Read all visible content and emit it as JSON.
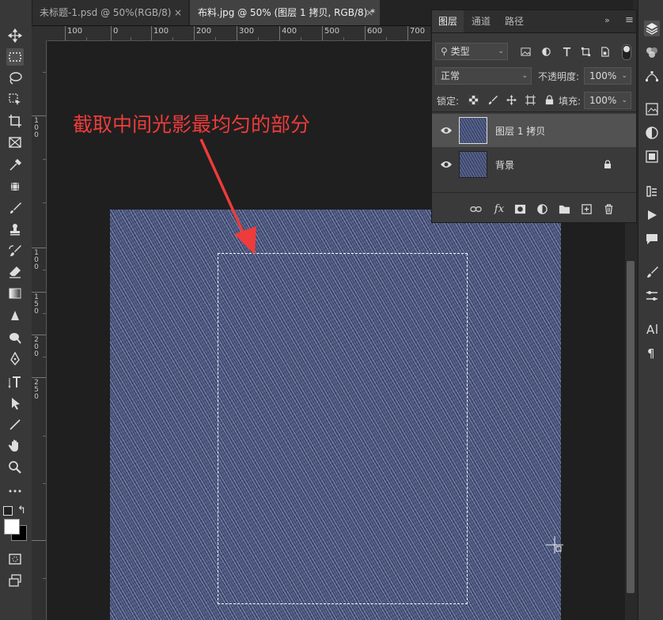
{
  "tabs": [
    {
      "title": "未标题-1.psd @ 50%(RGB/8)",
      "close": "×"
    },
    {
      "title": "布料.jpg @ 50% (图层 1 拷贝, RGB/8) *",
      "close": "×"
    }
  ],
  "ruler": {
    "h_labels": [
      "100",
      "0",
      "100",
      "200",
      "300",
      "400",
      "500",
      "600",
      "700"
    ],
    "v_labels": [
      "1",
      "0",
      "0",
      "1",
      "0",
      "0",
      "1",
      "5",
      "0",
      "2",
      "0",
      "0",
      "2",
      "5",
      "0"
    ]
  },
  "annotation": "截取中间光影最均匀的部分",
  "layers_panel": {
    "tabs": [
      "图层",
      "通道",
      "路径"
    ],
    "filter_kind": "类型",
    "blend_mode": "正常",
    "opacity_label": "不透明度:",
    "opacity_value": "100%",
    "lock_label": "锁定:",
    "fill_label": "填充:",
    "fill_value": "100%",
    "layers": [
      {
        "name": "图层 1 拷贝",
        "selected": true
      },
      {
        "name": "背景",
        "locked": true
      }
    ]
  },
  "colors": {
    "accent_annotation": "#ee3b3b",
    "denim": "#5a6690",
    "selected_layer": "#525252"
  }
}
